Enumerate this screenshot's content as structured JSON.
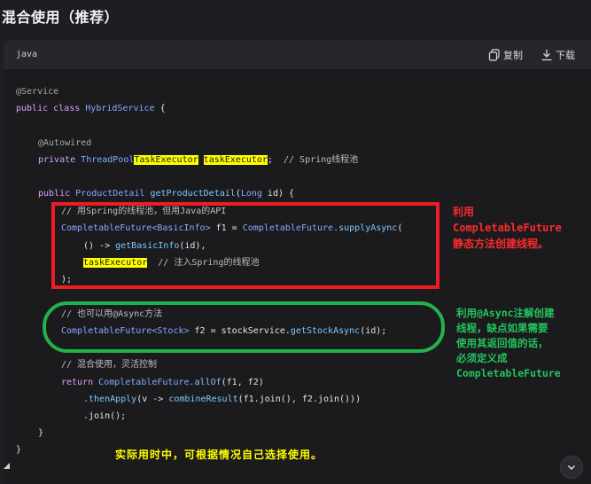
{
  "section_title": "混合使用（推荐）",
  "code_block": {
    "language": "java",
    "copy_label": "复制",
    "download_label": "下载"
  },
  "code": {
    "l1": "@Service",
    "l2_kw": "public class ",
    "l2_cls": "HybridService",
    "l2_tail": " {",
    "l3": "@Autowired",
    "l4_kw": "private ",
    "l4_cls": "ThreadPool",
    "l4_hl1": "TaskExecutor",
    "l4_hl2": "taskExecutor",
    "l4_tail": ";",
    "l4_cm": "  // Spring线程池",
    "l5_kw": "public ",
    "l5_cls": "ProductDetail ",
    "l5_fn": "getProductDetail",
    "l5_p1": "(",
    "l5_cls2": "Long",
    "l5_p2": " id) {",
    "l6": "// 用Spring的线程池，但用Java的API",
    "l7_cls": "CompletableFuture",
    "l7_gen": "<BasicInfo>",
    "l7_mid": " f1 = ",
    "l7_cls2": "CompletableFuture",
    "l7_fn": ".supplyAsync",
    "l7_tail": "(",
    "l8_a": "() -> ",
    "l8_fn": "getBasicInfo",
    "l8_b": "(id),",
    "l9_hl": "taskExecutor",
    "l9_cm": "  // 注入Spring的线程池",
    "l10": ");",
    "l11": "// 也可以用@Async方法",
    "l12_cls": "CompletableFuture",
    "l12_gen": "<Stock>",
    "l12_mid": " f2 = stockService.",
    "l12_fn": "getStockAsync",
    "l12_tail": "(id);",
    "l13": "// 混合使用，灵活控制",
    "l14_kw": "return ",
    "l14_cls": "CompletableFuture",
    "l14_fn": ".allOf",
    "l14_tail": "(f1, f2)",
    "l15_fn": ".thenApply",
    "l15_a": "(v -> ",
    "l15_fn2": "combineResult",
    "l15_b": "(f1.join(), f2.join()))",
    "l16": ".join();",
    "l17": "}",
    "l18": "}"
  },
  "notes": {
    "red_1": "利用",
    "red_2": "CompletableFuture",
    "red_3": "静态方法创建线程。",
    "green_1": "利用@Async注解创建",
    "green_2": "线程，缺点如果需要",
    "green_3": "使用其返回值的话，",
    "green_4": "必须定义成",
    "green_5": "CompletableFuture",
    "yellow": "实际用时中，可根据情况自己选择使用。"
  },
  "colors": {
    "red_box": "#ee1c24",
    "green_box": "#22b14c",
    "highlight": "#ffff00"
  }
}
